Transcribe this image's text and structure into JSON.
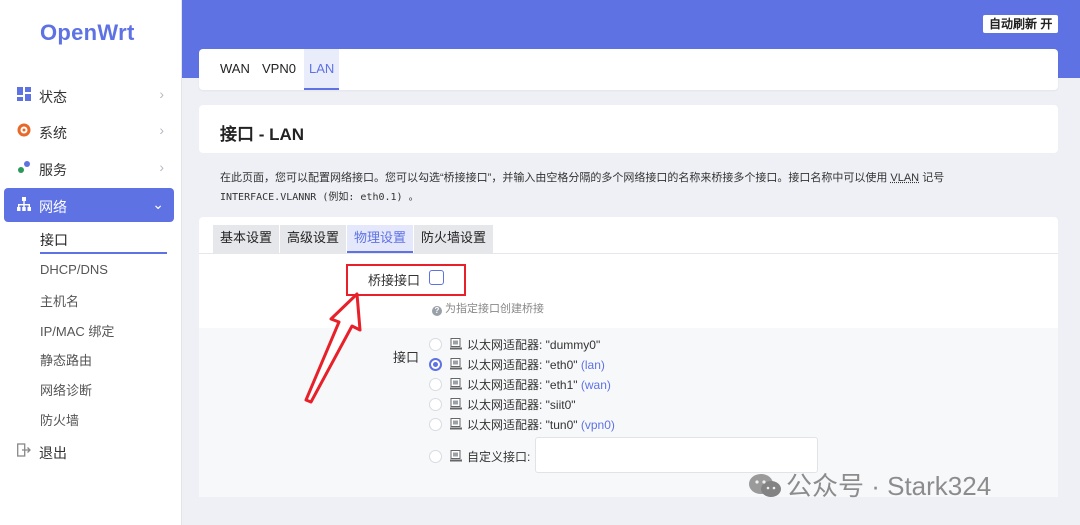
{
  "app": {
    "logo": "OpenWrt"
  },
  "sidebar": {
    "items": [
      {
        "label": "状态",
        "icon": "dashboard-icon"
      },
      {
        "label": "系统",
        "icon": "gear-icon"
      },
      {
        "label": "服务",
        "icon": "services-icon"
      },
      {
        "label": "网络",
        "icon": "network-icon"
      },
      {
        "label": "退出",
        "icon": "logout-icon"
      }
    ],
    "sub_items": [
      "接口",
      "DHCP/DNS",
      "主机名",
      "IP/MAC 绑定",
      "静态路由",
      "网络诊断",
      "防火墙"
    ]
  },
  "header": {
    "refresh_label": "自动刷新 开",
    "accent": "#5e72e4"
  },
  "top_tabs": [
    "WAN",
    "VPN0",
    "LAN"
  ],
  "page": {
    "title": "接口 - LAN",
    "desc_pre": "在此页面，您可以配置网络接口。您可以勾选“桥接接口”，并输入由空格分隔的多个网络接口的名称来桥接多个接口。接口名称中可以使用 ",
    "desc_vlan": "VLAN",
    "desc_post": " 记号",
    "desc_line2": "INTERFACE.VLANNR (例如: eth0.1) 。"
  },
  "section_tabs": [
    "基本设置",
    "高级设置",
    "物理设置",
    "防火墙设置"
  ],
  "form": {
    "bridge_label": "桥接接口",
    "bridge_checked": false,
    "bridge_hint": "为指定接口创建桥接",
    "interface_label": "接口",
    "options": [
      {
        "text": "以太网适配器: \"dummy0\"",
        "zone": "",
        "selected": false
      },
      {
        "text": "以太网适配器: \"eth0\"",
        "zone": "(lan)",
        "selected": true
      },
      {
        "text": "以太网适配器: \"eth1\"",
        "zone": "(wan)",
        "selected": false
      },
      {
        "text": "以太网适配器: \"siit0\"",
        "zone": "",
        "selected": false
      },
      {
        "text": "以太网适配器: \"tun0\"",
        "zone": "(vpn0)",
        "selected": false
      }
    ],
    "custom_label": "自定义接口:",
    "custom_value": ""
  },
  "annotation": {
    "color": "#e8202a"
  },
  "watermark": {
    "text": "公众号 · Stark324"
  }
}
